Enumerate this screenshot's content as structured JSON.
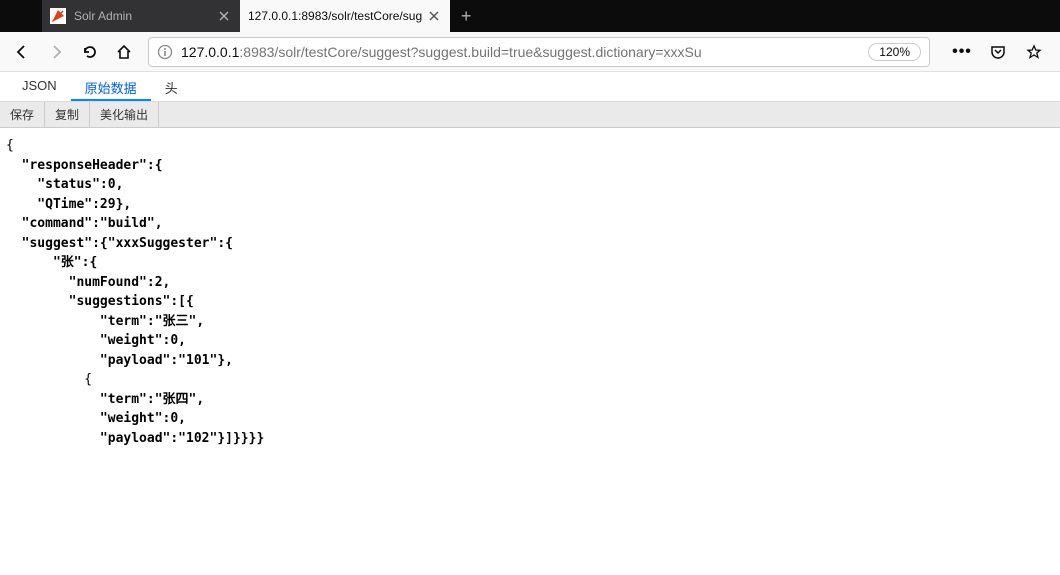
{
  "tabs": {
    "inactive": {
      "title": "Solr Admin"
    },
    "active": {
      "title": "127.0.0.1:8983/solr/testCore/sug"
    }
  },
  "url": {
    "host": "127.0.0.1",
    "rest": ":8983/solr/testCore/suggest?suggest.build=true&suggest.dictionary=xxxSu"
  },
  "zoom": "120%",
  "viewerTabs": {
    "json": "JSON",
    "raw": "原始数据",
    "headers": "头"
  },
  "actions": {
    "save": "保存",
    "copy": "复制",
    "pretty": "美化输出"
  },
  "json": {
    "l1": "{",
    "l2": "  \"responseHeader\":{",
    "l3": "    \"status\":0,",
    "l4": "    \"QTime\":29},",
    "l5": "  \"command\":\"build\",",
    "l6": "  \"suggest\":{\"xxxSuggester\":{",
    "l7": "      \"张\":{",
    "l8": "        \"numFound\":2,",
    "l9": "        \"suggestions\":[{",
    "l10": "            \"term\":\"张三\",",
    "l11": "            \"weight\":0,",
    "l12": "            \"payload\":\"101\"},",
    "l13": "          {",
    "l14": "            \"term\":\"张四\",",
    "l15": "            \"weight\":0,",
    "l16": "            \"payload\":\"102\"}]}}}}"
  }
}
